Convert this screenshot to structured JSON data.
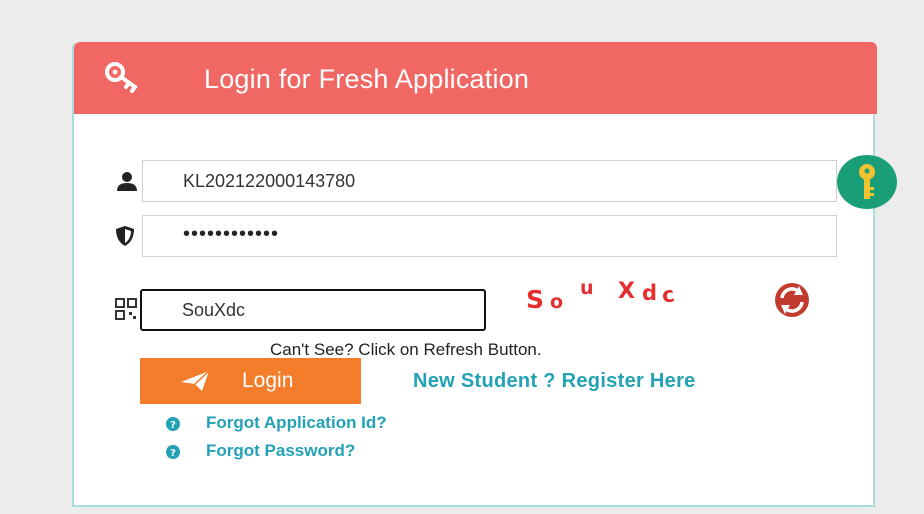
{
  "header": {
    "title": "Login for Fresh Application",
    "icon": "key-icon",
    "color": "#f06763"
  },
  "form": {
    "application_id": {
      "value": "KL202122000143780",
      "icon": "user-icon"
    },
    "password": {
      "value": "••••••••••••",
      "icon": "shield-icon"
    },
    "captcha": {
      "value": "SouXdc",
      "icon": "qr-code-icon",
      "image_text": [
        "S",
        "o",
        "u",
        "X",
        "d",
        "c"
      ],
      "refresh_icon": "refresh-icon",
      "hint": "Can't See? Click on Refresh Button."
    },
    "login_label": "Login",
    "login_color": "#f47d2b",
    "register_label": "New Student ? Register Here",
    "forgot_application_id": "Forgot Application Id?",
    "forgot_password": "Forgot Password?",
    "link_color": "#23a2b5"
  },
  "floating_badge": {
    "icon": "key-icon",
    "color": "#1a9e78"
  }
}
